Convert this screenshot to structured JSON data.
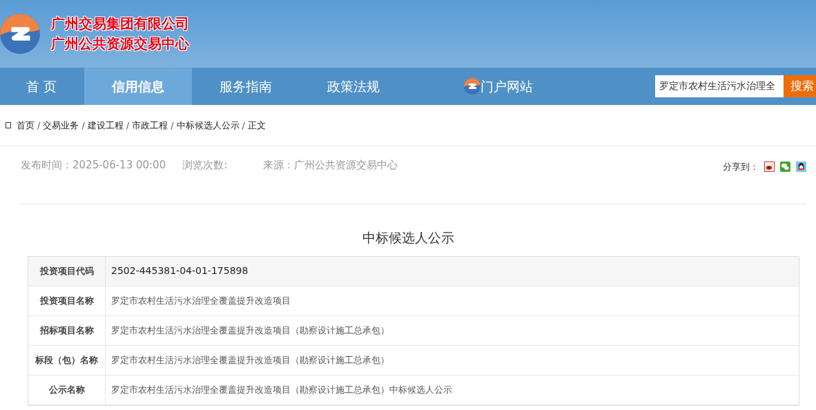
{
  "header": {
    "title_lines": [
      "广州交易集团有限公司",
      "广州公共资源交易中心"
    ]
  },
  "nav": {
    "items": [
      {
        "label": "首 页",
        "selected": false,
        "kind": "plain"
      },
      {
        "label": "信用信息",
        "selected": true,
        "kind": "plain"
      },
      {
        "label": "服务指南",
        "selected": false,
        "kind": "plain"
      },
      {
        "label": "政策法规",
        "selected": false,
        "kind": "plain"
      },
      {
        "label": "门户网站",
        "selected": false,
        "kind": "logo"
      }
    ],
    "search": {
      "value": "罗定市农村生活污水治理全",
      "button": "搜索"
    }
  },
  "breadcrumb": {
    "separator": "/",
    "items": [
      "首页",
      "交易业务",
      "建设工程",
      "市政工程",
      "中标候选人公示",
      "正文"
    ]
  },
  "meta": {
    "published": "发布时间：2025-06-13 00:00",
    "views": "浏览次数:",
    "source": "来源：广州公共资源交易中心",
    "share_label": "分享到："
  },
  "article": {
    "title": "中标候选人公示",
    "rows": [
      {
        "label": "投资项目代码",
        "value": "2502-445381-04-01-175898",
        "shaded": true
      },
      {
        "label": "投资项目名称",
        "value": "罗定市农村生活污水治理全覆盖提升改造项目",
        "shaded": false
      },
      {
        "label": "招标项目名称",
        "value": "罗定市农村生活污水治理全覆盖提升改造项目（勘察设计施工总承包）",
        "shaded": false
      },
      {
        "label": "标段（包）名称",
        "value": "罗定市农村生活污水治理全覆盖提升改造项目（勘察设计施工总承包）",
        "shaded": false
      },
      {
        "label": "公示名称",
        "value": "罗定市农村生活污水治理全覆盖提升改造项目（勘察设计施工总承包）中标候选人公示",
        "shaded": false
      }
    ]
  }
}
